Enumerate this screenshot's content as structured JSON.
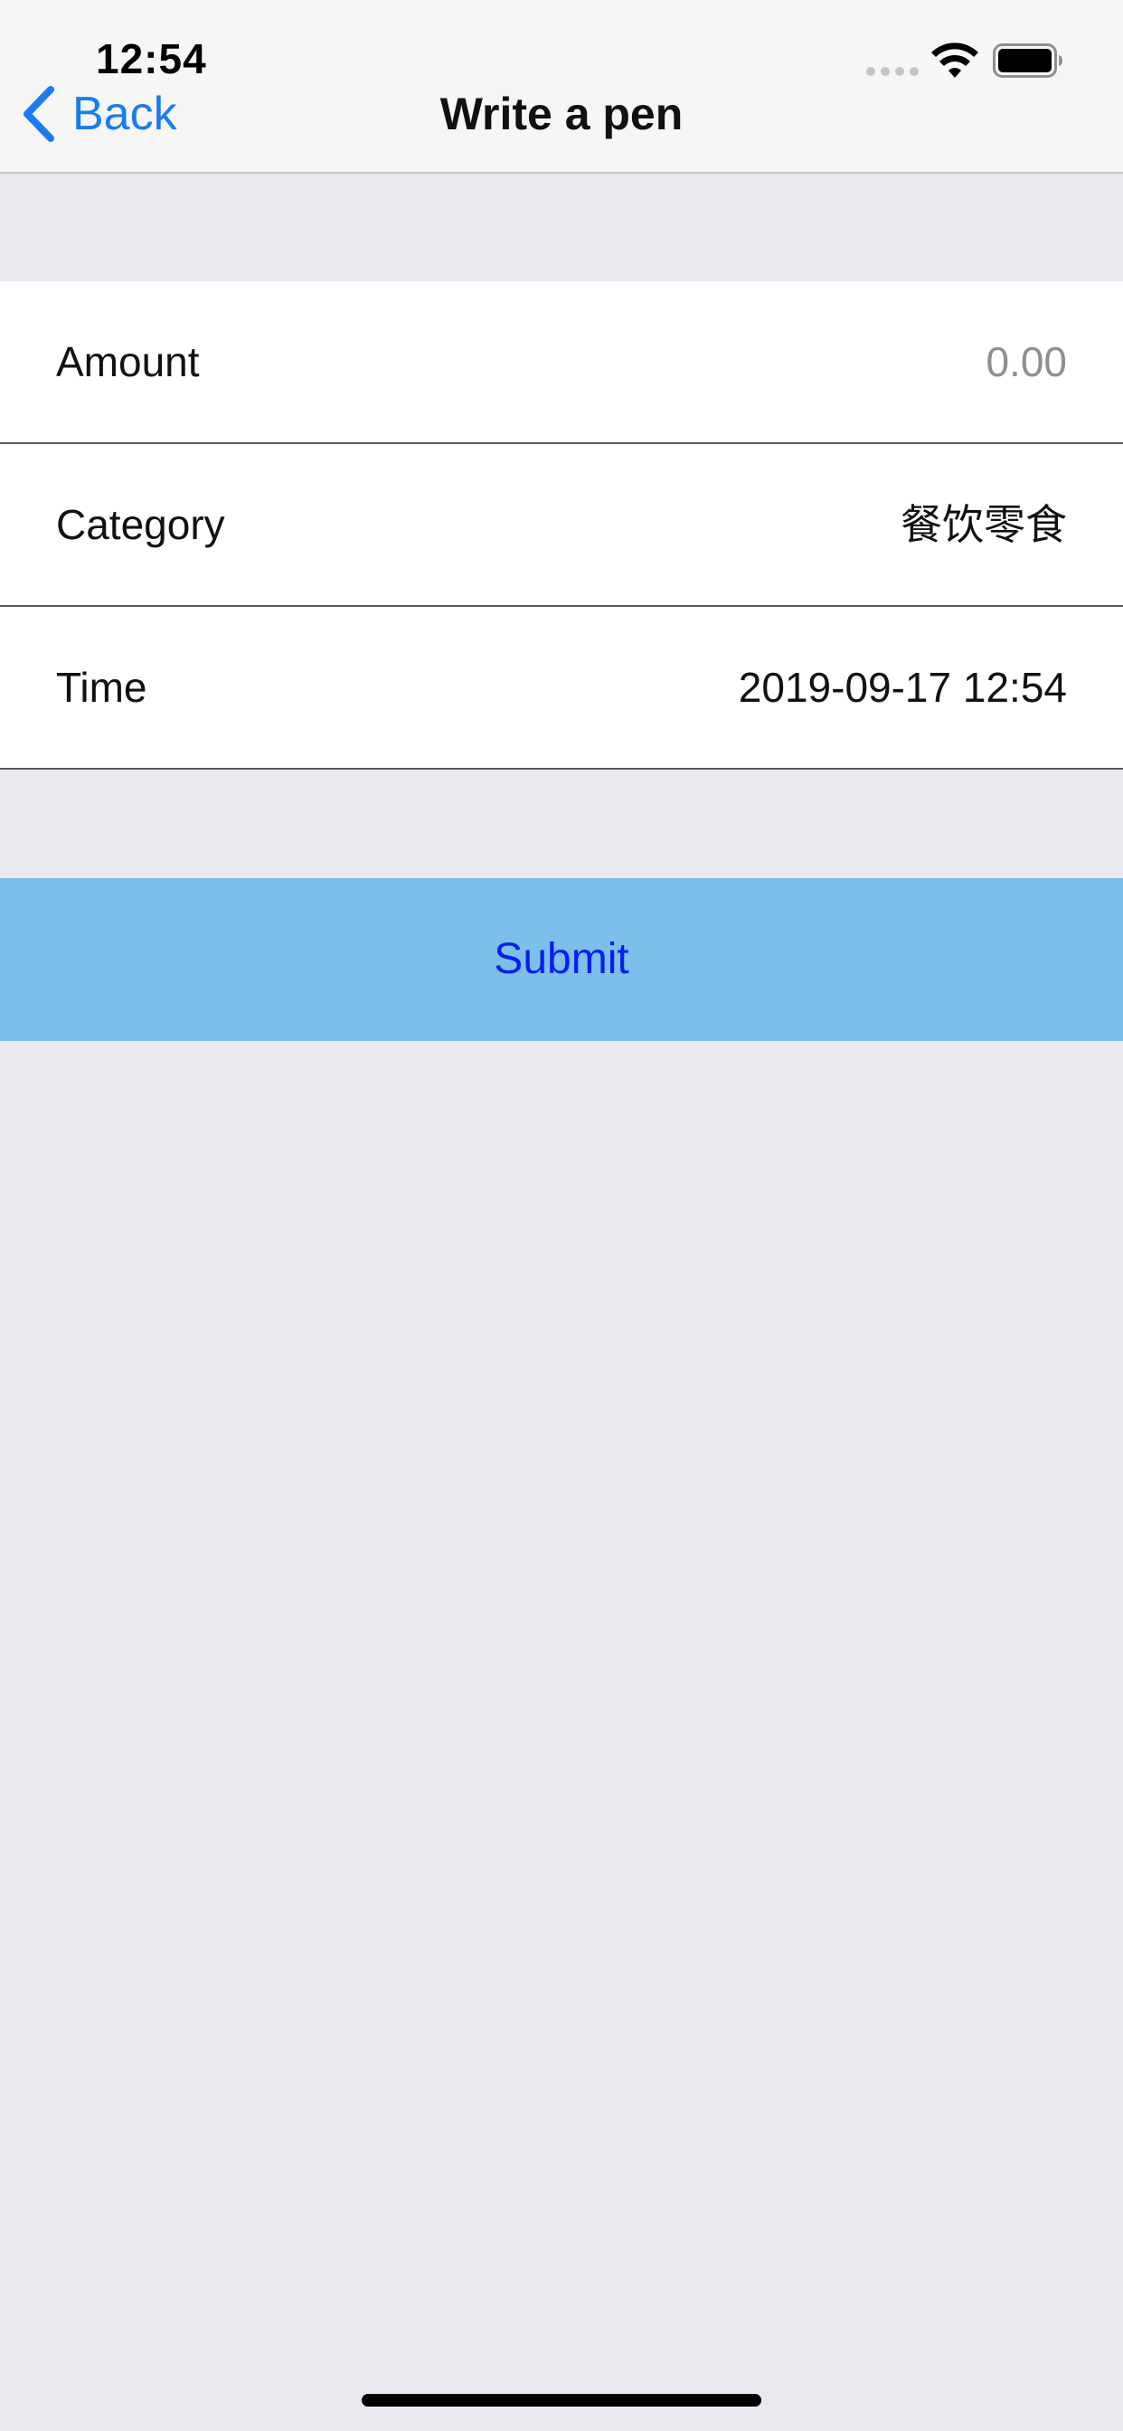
{
  "status_bar": {
    "time": "12:54",
    "icons": [
      "cellular-signal-icon",
      "wifi-icon",
      "battery-icon"
    ]
  },
  "nav": {
    "back_label": "Back",
    "back_icon": "chevron-left-icon",
    "title": "Write a pen"
  },
  "form": {
    "amount": {
      "label": "Amount",
      "placeholder": "0.00",
      "value": ""
    },
    "category": {
      "label": "Category",
      "value": "餐饮零食"
    },
    "time": {
      "label": "Time",
      "value": "2019-09-17 12:54"
    }
  },
  "submit": {
    "label": "Submit"
  },
  "colors": {
    "background": "#e9e8ef",
    "nav_background": "#f6f6f7",
    "accent": "#1a7cf0",
    "submit_background": "#7cbfea",
    "submit_text": "#0a1cf0",
    "placeholder": "#8e8e93"
  }
}
